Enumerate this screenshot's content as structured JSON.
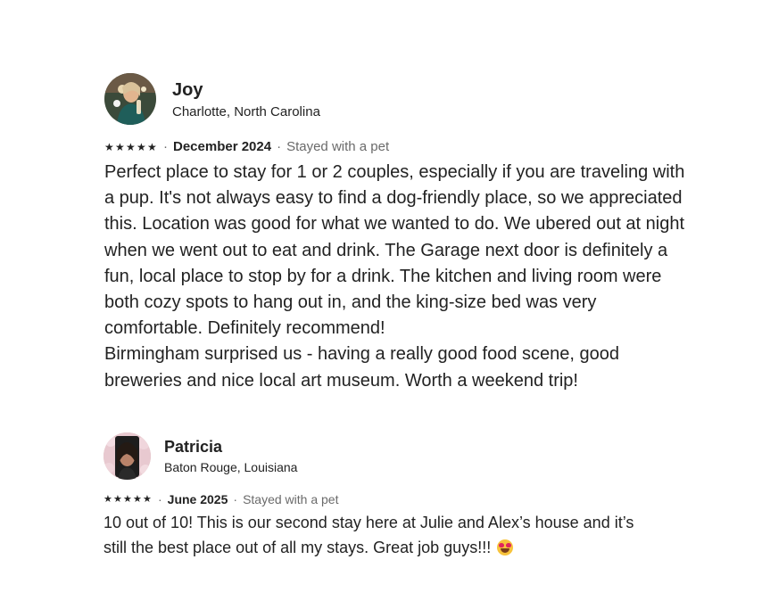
{
  "reviews": [
    {
      "avatar_icon": "user-photo-avatar",
      "name": "Joy",
      "location": "Charlotte, North Carolina",
      "rating": 5,
      "stars": "★★★★★",
      "date": "December 2024",
      "stay_type": "Stayed with a pet",
      "text": "Perfect place to stay for 1 or 2 couples, especially if you are traveling with\na pup. It's not always easy to find a dog-friendly place, so we appreciated\nthis. Location was good for what we wanted to do. We ubered out at night\nwhen we went out to eat and drink. The Garage next door is definitely a\nfun, local place to stop by for a drink. The kitchen and living room were\nboth cozy spots to hang out in, and the king-size bed was very\ncomfortable. Definitely recommend!\nBirmingham surprised us - having a really good food scene, good\nbreweries and nice local art museum. Worth a weekend trip!"
    },
    {
      "avatar_icon": "user-photo-avatar",
      "name": "Patricia",
      "location": "Baton Rouge, Louisiana",
      "rating": 5,
      "stars": "★★★★★",
      "date": "June 2025",
      "stay_type": "Stayed with a pet",
      "text": "10 out of 10! This is our second stay here at Julie and Alex’s house and it’s\nstill the best place out of all my stays. Great job guys!!!",
      "emoji": "heart-eyes-emoji"
    }
  ],
  "separator": "·",
  "colors": {
    "text_primary": "#222222",
    "text_secondary": "#6a6a6a",
    "background": "#ffffff"
  }
}
